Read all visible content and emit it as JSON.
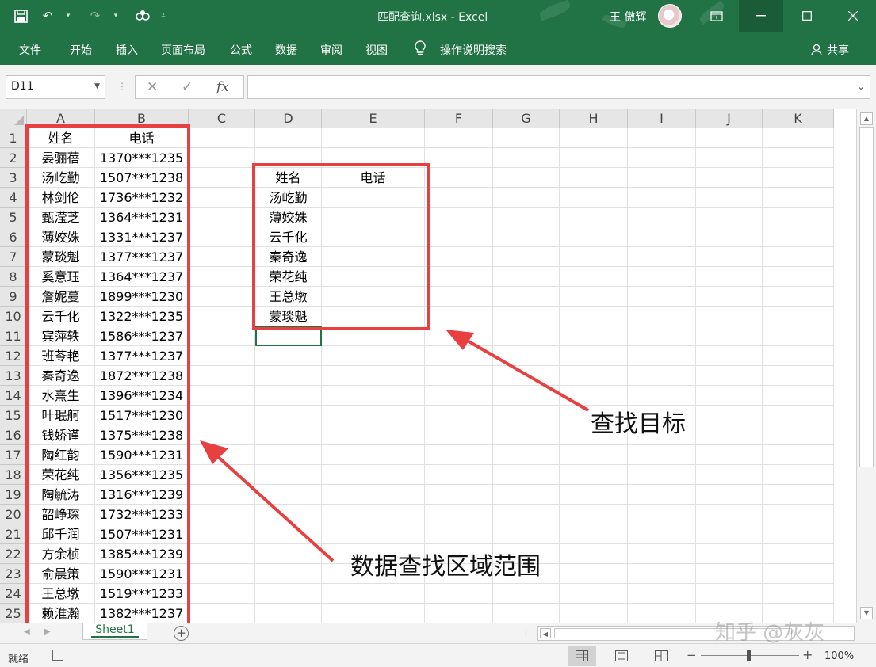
{
  "window": {
    "title": "匹配查询.xlsx  -  Excel",
    "user": "王 傲辉"
  },
  "ribbon": {
    "tabs": [
      "文件",
      "开始",
      "插入",
      "页面布局",
      "公式",
      "数据",
      "审阅",
      "视图"
    ],
    "tell_me": "操作说明搜索",
    "share": "共享"
  },
  "formula_bar": {
    "name_box": "D11",
    "cancel": "✕",
    "enter": "✓",
    "fx": "fx",
    "value": ""
  },
  "columns": [
    "A",
    "B",
    "C",
    "D",
    "E",
    "F",
    "G",
    "H",
    "I",
    "J",
    "K"
  ],
  "rows": [
    "1",
    "2",
    "3",
    "4",
    "5",
    "6",
    "7",
    "8",
    "9",
    "10",
    "11",
    "12",
    "13",
    "14",
    "15",
    "16",
    "17",
    "18",
    "19",
    "20",
    "21",
    "22",
    "23",
    "24",
    "25"
  ],
  "source_table": {
    "headers": [
      "姓名",
      "电话"
    ],
    "rows": [
      [
        "晏骊蓓",
        "1370***1235"
      ],
      [
        "汤屹勤",
        "1507***1238"
      ],
      [
        "林剑伦",
        "1736***1232"
      ],
      [
        "甄滢芝",
        "1364***1231"
      ],
      [
        "薄姣姝",
        "1331***1237"
      ],
      [
        "蒙琰魁",
        "1377***1237"
      ],
      [
        "奚意珏",
        "1364***1237"
      ],
      [
        "詹妮蔓",
        "1899***1230"
      ],
      [
        "云千化",
        "1322***1235"
      ],
      [
        "宾萍轶",
        "1586***1237"
      ],
      [
        "班苓艳",
        "1377***1237"
      ],
      [
        "秦奇逸",
        "1872***1238"
      ],
      [
        "水熹生",
        "1396***1234"
      ],
      [
        "叶珉舸",
        "1517***1230"
      ],
      [
        "钱娇谨",
        "1375***1238"
      ],
      [
        "陶红韵",
        "1590***1231"
      ],
      [
        "荣花纯",
        "1356***1235"
      ],
      [
        "陶毓涛",
        "1316***1239"
      ],
      [
        "韶峥琛",
        "1732***1233"
      ],
      [
        "邱千润",
        "1507***1231"
      ],
      [
        "方余桢",
        "1385***1239"
      ],
      [
        "俞晨策",
        "1590***1231"
      ],
      [
        "王总墩",
        "1519***1233"
      ],
      [
        "赖淮瀚",
        "1382***1237"
      ]
    ]
  },
  "target_table": {
    "headers": [
      "姓名",
      "电话"
    ],
    "names": [
      "汤屹勤",
      "薄姣姝",
      "云千化",
      "秦奇逸",
      "荣花纯",
      "王总墩",
      "蒙琰魁"
    ]
  },
  "annotations": {
    "target_label": "查找目标",
    "range_label": "数据查找区域范围"
  },
  "colors": {
    "excel_green": "#217346",
    "highlight_red": "#e84040"
  },
  "sheet_tabs": [
    "Sheet1"
  ],
  "status_bar": {
    "ready": "就绪",
    "zoom": "100%"
  },
  "watermark": "知乎 @灰灰"
}
